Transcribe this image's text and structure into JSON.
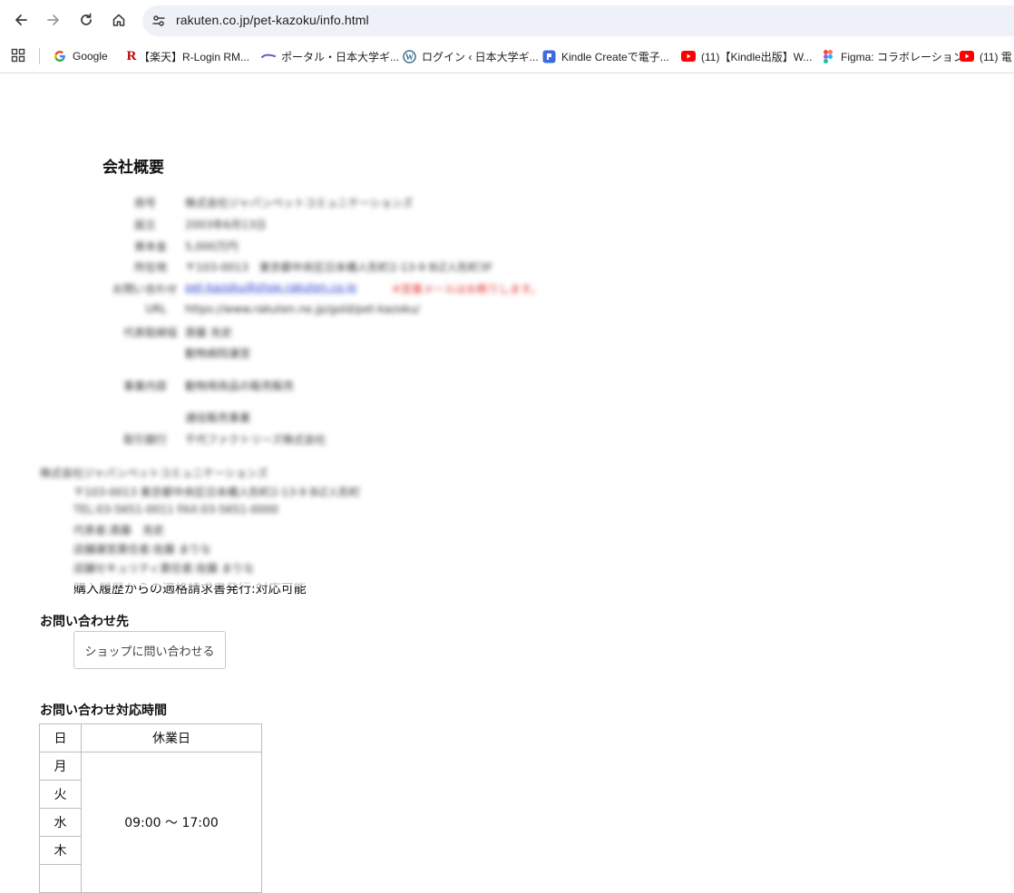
{
  "browser": {
    "url": "rakuten.co.jp/pet-kazoku/info.html",
    "bookmarks": [
      {
        "label": "Google",
        "icon": "google-icon"
      },
      {
        "label": "【楽天】R-Login RM...",
        "icon": "rakuten-r-icon"
      },
      {
        "label": "ポータル・日本大学ギ...",
        "icon": "portal-icon"
      },
      {
        "label": "ログイン ‹ 日本大学ギ...",
        "icon": "wordpress-icon"
      },
      {
        "label": "Kindle Createで電子...",
        "icon": "kindle-create-icon"
      },
      {
        "label": "(11)【Kindle出版】W...",
        "icon": "youtube-icon"
      },
      {
        "label": "Figma: コラボレーション...",
        "icon": "figma-icon"
      },
      {
        "label": "(11) 電",
        "icon": "youtube-icon"
      }
    ]
  },
  "company": {
    "title": "会社概要",
    "rows": [
      {
        "label": "商号",
        "value": "株式会社ジャパンペットコミュニケーションズ"
      },
      {
        "label": "設立",
        "value": "2003年6月13日"
      },
      {
        "label": "資本金",
        "value": "5,000万円"
      },
      {
        "label": "所在地",
        "value": "〒103-0013　東京都中央区日本橋人形町2-13-9 BiZ人形町3F"
      },
      {
        "label": "お問い合わせ",
        "value": "pet-kazoku@shop.rakuten.co.jp",
        "note": "※営業メールはお断りします。"
      },
      {
        "label": "URL",
        "value": "https://www.rakuten.ne.jp/gold/pet-kazoku/"
      },
      {
        "label": "代表取締役",
        "value": "斎藤 充史",
        "value2": "動物病院運営"
      },
      {
        "label": "事業内容",
        "value": "動物用商品の販売販売",
        "value2": "通信販売事業"
      },
      {
        "label": "取引銀行",
        "value": "千代ファクトリーズ株式会社"
      }
    ],
    "footer_lines": [
      "株式会社ジャパンペットコミュニケーションズ",
      "〒103-0013 東京都中央区日本橋人形町2-13-9 BiZ人形町",
      "TEL:03-5651-0011 FAX:03-5651-0000",
      "代表者:斎藤　充史",
      "店舗運営責任者:佐藤 まりな",
      "店舗セキュリティ責任者:佐藤 まりな"
    ],
    "invoice_line": "購入履歴からの適格請求書発行:対応可能"
  },
  "contact": {
    "heading": "お問い合わせ先",
    "button_label": "ショップに問い合わせる"
  },
  "hours": {
    "heading": "お問い合わせ対応時間",
    "rows": [
      {
        "day": "日",
        "time": "休業日"
      },
      {
        "day": "月",
        "time": "09:00 〜 17:00"
      },
      {
        "day": "火"
      },
      {
        "day": "水"
      },
      {
        "day": "木"
      },
      {
        "day": ""
      }
    ]
  }
}
